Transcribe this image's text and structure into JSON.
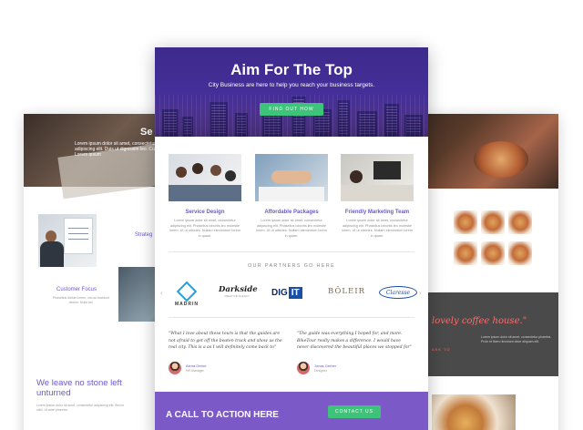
{
  "left_card": {
    "hero_title": "Se",
    "hero_text": "Lorem ipsum dolor sit amet, consectetur adipiscing elit. Duis ut dignissim leo. Curabitur",
    "hero_link": "Lorem ipsum",
    "strategy_label": "Strateg",
    "customer_focus": "Customer Focus",
    "customer_text": "Phasellus dictum lorem, nisi ac tincidunt dictum. Nulla vel.",
    "big_heading": "We leave no stone left unturned",
    "small_text": "Lorem ipsum dolor sit amet, consectetur adipiscing elit. Sed in nibh. Ut ante pharetra."
  },
  "right_card": {
    "coffee_heading": "lovely coffee house.\"",
    "coffee_text": "Lorem ipsum dolor sit amet, consectetur pharetra. Proin et libero tincidunt dolor aliquam elit.",
    "coffee_link": "ASK TO"
  },
  "hero": {
    "title": "Aim For The Top",
    "subtitle": "City Business are here to help you reach your business targets.",
    "button": "FIND OUT HOW"
  },
  "features": [
    {
      "title": "Service Design",
      "text": "Lorem ipsum dolor sit amet, consectetur adipiscing elit. Phasellus lobortis leo molestie lorem. Ut ut ultricies. Nullam elementum lorem in quam."
    },
    {
      "title": "Affordable Packages",
      "text": "Lorem ipsum dolor sit amet, consectetur adipiscing elit. Phasellus lobortis leo molestie lorem. Ut ut ultricies. Nullam elementum lorem in quam."
    },
    {
      "title": "Friendly Marketing Team",
      "text": "Lorem ipsum dolor sit amet, consectetur adipiscing elit. Phasellus lobortis leo molestie lorem. Ut ut ultricies. Nullam elementum lorem in quam."
    }
  ],
  "partners": {
    "heading": "OUR PARTNERS GO HERE",
    "arrow_prev": "‹",
    "arrow_next": "›",
    "logos": {
      "madrin": "MADRIN",
      "darkside": "Darkside",
      "darkside_tag": "CREATIVE AGENCY",
      "dig": "DIG",
      "it": "IT",
      "boleir": "BÔLEIR",
      "laresse": "Claresse"
    }
  },
  "testimonials": [
    {
      "quote": "\"What I love about these tours is that the guides are not afraid to get off the beaten track and show us the real city. This is a as I will definitely come back to\"",
      "name": "Alena Divine",
      "role": "HR Manager"
    },
    {
      "quote": "\"The guide was everything I hoped for, and more. BikeTour really makes a difference. I would have never discovered the beautiful places we stopped for\"",
      "name": "Jonas Gerber",
      "role": "Designer"
    }
  ],
  "cta": {
    "title": "A CALL TO ACTION HERE",
    "button": "CONTACT US"
  },
  "colors": {
    "hero_purple": "#452f9a",
    "accent_purple": "#6a5acd",
    "cta_purple": "#7b5ac8",
    "button_green": "#3ec47a",
    "coffee_red": "#ff6b6b"
  }
}
